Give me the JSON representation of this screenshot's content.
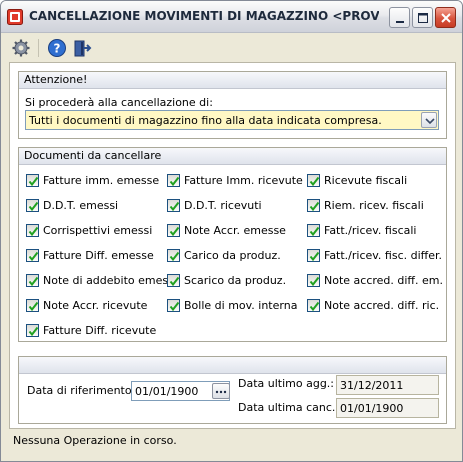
{
  "window": {
    "title": "CANCELLAZIONE MOVIMENTI DI MAGAZZINO <PROVA - AZ...",
    "controls": [
      "minimize-icon",
      "maximize-icon",
      "close-icon"
    ],
    "colors": {
      "title_text": "#1e2a3c",
      "close_button": "#d8533d"
    }
  },
  "toolbar": {
    "icons": [
      "gear-icon",
      "help-icon",
      "exit-door-icon"
    ]
  },
  "attenzione": {
    "header": "Attenzione!",
    "prompt": "Si procederà alla cancellazione di:",
    "selected_option": "Tutti i documenti di magazzino fino alla data indicata compresa.",
    "field_color": "#fff8c4"
  },
  "documenti": {
    "header": "Documenti da cancellare",
    "col1": [
      {
        "label": "Fatture imm. emesse",
        "checked": true
      },
      {
        "label": "D.D.T. emessi",
        "checked": true
      },
      {
        "label": "Corrispettivi emessi",
        "checked": true
      },
      {
        "label": "Fatture Diff. emesse",
        "checked": true
      },
      {
        "label": "Note di addebito emesse",
        "checked": true
      },
      {
        "label": "Note Accr. ricevute",
        "checked": true
      },
      {
        "label": "Fatture Diff. ricevute",
        "checked": true
      }
    ],
    "col2": [
      {
        "label": "Fatture Imm. ricevute",
        "checked": true
      },
      {
        "label": "D.D.T. ricevuti",
        "checked": true
      },
      {
        "label": "Note Accr. emesse",
        "checked": true
      },
      {
        "label": "Carico da produz.",
        "checked": true
      },
      {
        "label": "Scarico da produz.",
        "checked": true
      },
      {
        "label": "Bolle di mov. interna",
        "checked": true
      }
    ],
    "col3": [
      {
        "label": "Ricevute fiscali",
        "checked": true
      },
      {
        "label": "Riem. ricev. fiscali",
        "checked": true
      },
      {
        "label": "Fatt./ricev. fiscali",
        "checked": true
      },
      {
        "label": "Fatt./ricev. fisc. differ.",
        "checked": true
      },
      {
        "label": "Note accred. diff. em.",
        "checked": true
      },
      {
        "label": "Note accred. diff. ric.",
        "checked": true
      }
    ]
  },
  "dates": {
    "riferimento_label": "Data di riferimento:",
    "riferimento_value": "01/01/1900",
    "ultimo_agg_label": "Data ultimo agg.:",
    "ultimo_agg_value": "31/12/2011",
    "ultima_canc_label": "Data ultima canc.:",
    "ultima_canc_value": "01/01/1900",
    "dots_button": "..."
  },
  "status": {
    "text": "Nessuna Operazione in corso."
  }
}
